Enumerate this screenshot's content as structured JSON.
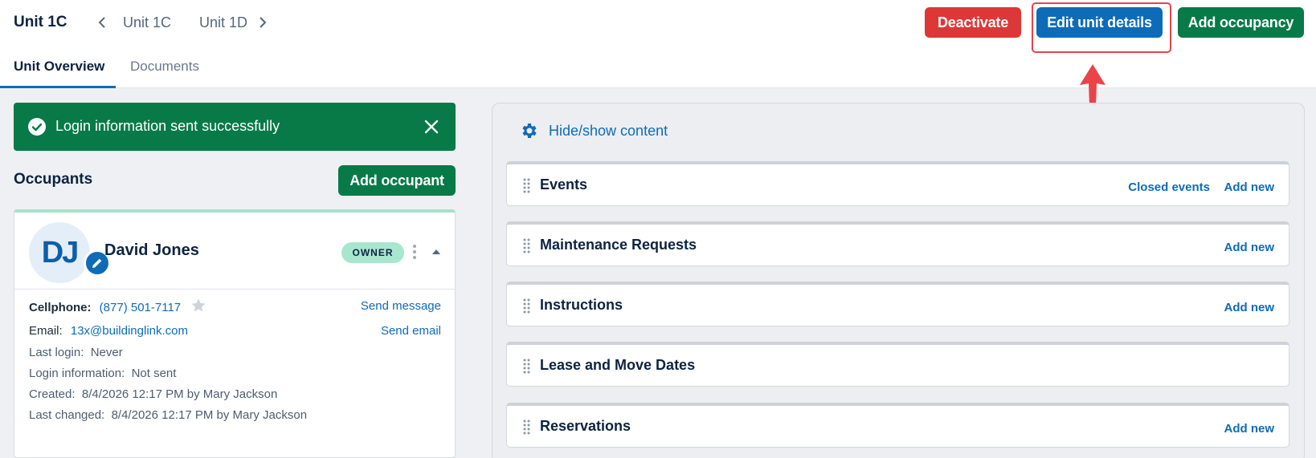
{
  "header": {
    "unit_title": "Unit 1C",
    "prev_unit": "Unit 1C",
    "next_unit": "Unit 1D",
    "buttons": {
      "deactivate": "Deactivate",
      "edit_unit_details": "Edit unit details",
      "add_occupancy": "Add occupancy"
    },
    "tabs": [
      {
        "label": "Unit Overview",
        "active": true
      },
      {
        "label": "Documents",
        "active": false
      }
    ]
  },
  "toast": {
    "message": "Login information sent successfully",
    "icon": "check-circle-icon",
    "color": "#077a48"
  },
  "occupants": {
    "heading": "Occupants",
    "add_button": "Add occupant",
    "items": [
      {
        "initials": "DJ",
        "name": "David Jones",
        "badge": "OWNER",
        "cellphone_label": "Cellphone:",
        "cellphone": "(877) 501-7117",
        "email_label": "Email:",
        "email": "13x@buildinglink.com",
        "send_message": "Send message",
        "send_email": "Send email",
        "last_login": "Last login:  Never",
        "login_information": "Login information:  Not sent",
        "created": "Created:  8/4/2026 12:17 PM by Mary Jackson",
        "last_changed": "Last changed:  8/4/2026 12:17 PM by Mary Jackson"
      }
    ]
  },
  "panel": {
    "hide_show": "Hide/show content",
    "sections": [
      {
        "title": "Events",
        "links": [
          "Closed events",
          "Add new"
        ]
      },
      {
        "title": "Maintenance Requests",
        "links": [
          "Add new"
        ]
      },
      {
        "title": "Instructions",
        "links": [
          "Add new"
        ]
      },
      {
        "title": "Lease and Move Dates",
        "links": []
      },
      {
        "title": "Reservations",
        "links": [
          "Add new"
        ]
      }
    ]
  },
  "colors": {
    "brand_blue": "#0e6bb8",
    "danger_red": "#dc3838",
    "success_green": "#077a48",
    "annotation_red": "#e0464c"
  }
}
